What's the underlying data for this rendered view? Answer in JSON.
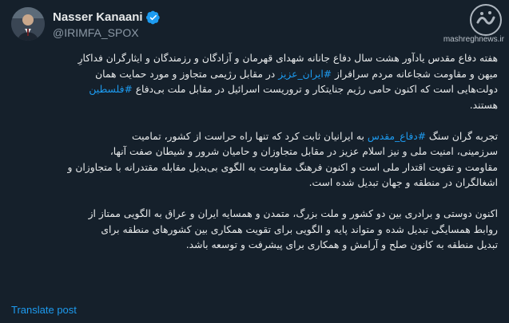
{
  "author": {
    "display_name": "Nasser Kanaani",
    "handle": "@IRIMFA_SPOX",
    "verified_icon": "verified-badge-icon"
  },
  "watermark": {
    "logo_text": "مشرق",
    "url": "mashreghnews.ir"
  },
  "post": {
    "paragraph1": {
      "line1": "هفته دفاع مقدس یادآور هشت سال دفاع جانانه شهدای قهرمان و آزادگان و رزمندگان و ایثارگران فداکارِ",
      "line2": "میهن و مقاومت شجاعانه مردم سرافراز #ایران_عزیز در مقابل رژیمی متجاوز و مورد حمایت همان",
      "line3_before": "دولت‌هایی است که اکنون حامی رژیم جنایتکار و تروریست اسرائیل در مقابل ملت بی‌دفاع ",
      "line3_hashtag": "#فلسطین",
      "line4": "هستند."
    },
    "paragraph2": {
      "line1_before": "تجربه گران سنگ ",
      "line1_hashtag": "#دفاع_مقدس",
      "line1_after": " به ایرانیان ثابت کرد که تنها راه حراست از کشور، تمامیت",
      "line2": "سرزمینی، امنیت ملی و نیز اسلام عزیز در مقابل متجاوزان و حامیان شرور و شیطان صفت آنها،",
      "line3": "مقاومت و تقویت اقتدار ملی است و اکنون فرهنگ مقاومت به الگوی بی‌بدیل مقابله مقتدرانه با متجاوزان و",
      "line4": "اشغالگران در منطقه و جهان تبدیل شده است."
    },
    "paragraph3": {
      "line1": "اکنون دوستی و برادری بین دو کشور و ملت بزرگ، متمدن و همسایه ایران و عراق به الگویی ممتاز از",
      "line2": "روابط همسایگی تبدیل شده و متواند پایه و الگویی برای تقویت همکاری بین کشورهای منطقه برای",
      "line3": "تبدیل منطقه به کانون صلح و آرامش و همکاری برای پیشرفت و توسعه باشد."
    },
    "hashtag_iran": "#ایران_عزیز"
  },
  "translate_label": "Translate post",
  "colors": {
    "background": "#15202b",
    "text": "#e7e9ea",
    "secondary": "#8b98a5",
    "link": "#1d9bf0"
  }
}
